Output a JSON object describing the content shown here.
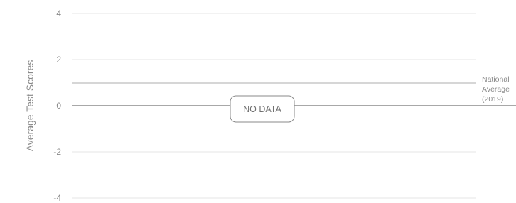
{
  "chart_data": {
    "type": "line",
    "title": "",
    "xlabel": "",
    "ylabel": "Average Test Scores",
    "ylim": [
      -4,
      4
    ],
    "yticks": [
      4,
      2,
      0,
      -2,
      -4
    ],
    "grid": true,
    "series": [],
    "zero_line": 0,
    "reference_line": {
      "value": 1,
      "label_lines": [
        "National",
        "Average",
        "(2019)"
      ],
      "color": "#d6d6d6"
    },
    "empty_message": "NO DATA",
    "colors": {
      "grid": "#e4e4e4",
      "zero_line": "#8c8c8c",
      "text": "#8a8a8a",
      "message_border": "#8a8a8a"
    }
  }
}
